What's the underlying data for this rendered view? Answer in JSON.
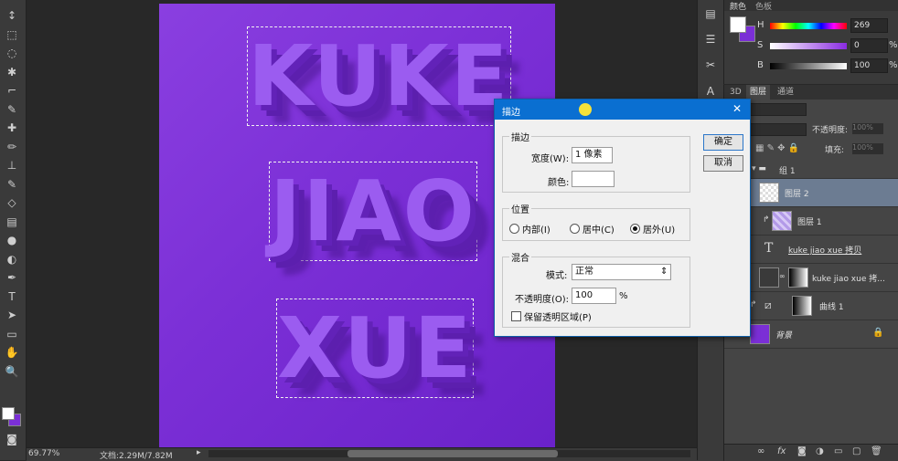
{
  "toolbar": {
    "tools": [
      "move-tool-icon",
      "marquee-tool-icon",
      "lasso-tool-icon",
      "quick-select-tool-icon",
      "crop-tool-icon",
      "eyedropper-tool-icon",
      "healing-brush-icon",
      "brush-tool-icon",
      "clone-stamp-icon",
      "history-brush-icon",
      "eraser-tool-icon",
      "gradient-tool-icon",
      "blur-tool-icon",
      "dodge-tool-icon",
      "pen-tool-icon",
      "text-tool-icon",
      "path-select-icon",
      "shape-tool-icon",
      "hand-tool-icon",
      "zoom-tool-icon"
    ],
    "tool_glyphs": [
      "↕",
      "⬚",
      "◌",
      "✱",
      "⌐",
      "✎",
      "✚",
      "✏",
      "⊥",
      "✎",
      "◇",
      "▤",
      "●",
      "◐",
      "✒",
      "T",
      "➤",
      "▭",
      "✋",
      "🔍"
    ]
  },
  "canvas": {
    "lines": [
      "KUKE",
      "JIAO",
      "XUE"
    ],
    "bg_color": "#7b2fd6"
  },
  "status": {
    "zoom": "69.77%",
    "doc": "文档:2.29M/7.82M",
    "arrow": "▸"
  },
  "color_panel": {
    "tab1": "颜色",
    "tab2": "色板",
    "rows": [
      {
        "label": "H",
        "value": "269",
        "unit": ""
      },
      {
        "label": "S",
        "value": "0",
        "unit": "%"
      },
      {
        "label": "B",
        "value": "100",
        "unit": "%"
      }
    ]
  },
  "layers_panel": {
    "tabs": [
      "3D",
      "图层",
      "通道"
    ],
    "opacity_label": "不透明度:",
    "opacity_value": "100%",
    "fill_label": "填充:",
    "fill_value": "100%",
    "group_name": "组 1",
    "layers": [
      {
        "name": "图层 2",
        "selected": true
      },
      {
        "name": "图层 1",
        "selected": false
      },
      {
        "name": "kuke jiao xue 拷贝",
        "selected": false
      },
      {
        "name": "kuke jiao xue 拷...",
        "selected": false
      },
      {
        "name": "曲线 1",
        "selected": false
      },
      {
        "name": "背景",
        "selected": false
      }
    ]
  },
  "dialog": {
    "title": "描边",
    "close": "✕",
    "ok": "确定",
    "cancel": "取消",
    "stroke_group": "描边",
    "width_label": "宽度(W):",
    "width_value": "1 像素",
    "color_label": "颜色:",
    "position_group": "位置",
    "pos_inside": "内部(I)",
    "pos_center": "居中(C)",
    "pos_outside": "居外(U)",
    "blend_group": "混合",
    "mode_label": "模式:",
    "mode_value": "正常",
    "opacity_label": "不透明度(O):",
    "opacity_value": "100",
    "opacity_unit": "%",
    "preserve_label": "保留透明区域(P)"
  }
}
